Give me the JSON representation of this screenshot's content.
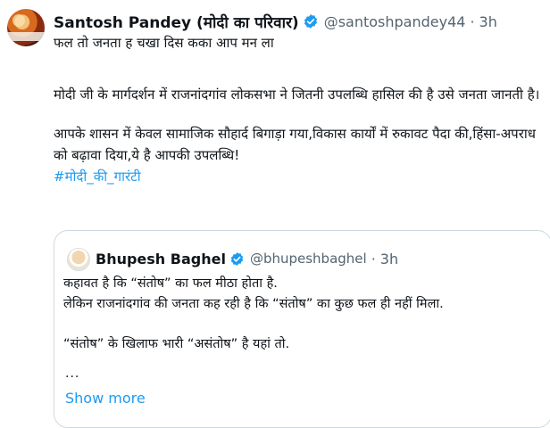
{
  "tweet": {
    "author_name": "Santosh Pandey (मोदी का परिवार)",
    "handle": "@santoshpandey44",
    "separator": "·",
    "time": "3h",
    "lines": {
      "line1": "फल तो जनता ह चखा दिस कका आप मन ला",
      "line2": "मोदी जी के मार्गदर्शन में राजनांदगांव लोकसभा ने जितनी उपलब्धि हासिल की है उसे जनता जानती है।",
      "line3": "आपके शासन में केवल सामाजिक सौहार्द बिगाड़ा गया,विकास कार्यों में रुकावट पैदा की,हिंसा-अपराध को बढ़ावा दिया,ये है आपकी उपलब्धि!",
      "hashtag": "#मोदी_की_गारंटी"
    }
  },
  "quoted": {
    "author_name": "Bhupesh Baghel",
    "handle": "@bhupeshbaghel",
    "separator": "·",
    "time": "3h",
    "line1": "कहावत है कि “संतोष” का फल मीठा होता है.",
    "line2": "लेकिन राजनांदगांव की जनता कह रही है कि “संतोष” का कुछ फल ही नहीं मिला.",
    "line3": "“संतोष” के खिलाफ भारी “असंतोष” है यहां तो.",
    "ellipsis": "...",
    "show_more": "Show more"
  },
  "colors": {
    "link": "#1d9bf0",
    "secondary_text": "#536471",
    "verified_badge": "#1d9bf0",
    "border": "#cfd9de"
  },
  "icons": {
    "verified": "verified-badge-icon"
  }
}
